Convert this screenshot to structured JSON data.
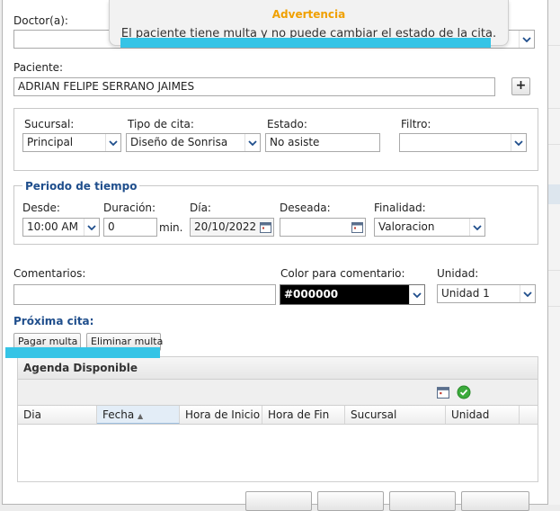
{
  "toast": {
    "title": "Advertencia",
    "message": "El paciente tiene multa y no puede cambiar el estado de la cita."
  },
  "form": {
    "doctor_label": "Doctor(a):",
    "doctor_value": "",
    "paciente_label": "Paciente:",
    "paciente_value": "ADRIAN FELIPE SERRANO JAIMES",
    "add_button": "+",
    "sucursal_label": "Sucursal:",
    "sucursal_value": "Principal",
    "tipo_label": "Tipo de cita:",
    "tipo_value": "Diseño de Sonrisa",
    "estado_label": "Estado:",
    "estado_value": "No asiste",
    "filtro_label": "Filtro:",
    "filtro_value": ""
  },
  "periodo": {
    "legend": "Periodo de tiempo",
    "desde_label": "Desde:",
    "desde_value": "10:00 AM",
    "duracion_label": "Duración:",
    "duracion_value": "0",
    "duracion_unit": "min.",
    "dia_label": "Día:",
    "dia_value": "20/10/2022",
    "deseada_label": "Deseada:",
    "deseada_value": "",
    "finalidad_label": "Finalidad:",
    "finalidad_value": "Valoracion"
  },
  "comentarios": {
    "label": "Comentarios:",
    "value": "",
    "color_label": "Color para comentario:",
    "color_value": "#000000",
    "unidad_label": "Unidad:",
    "unidad_value": "Unidad 1"
  },
  "proxima": {
    "label": "Próxima cita:",
    "pagar": "Pagar multa",
    "eliminar": "Eliminar multa"
  },
  "grid": {
    "title": "Agenda Disponible",
    "columns": [
      "Dia",
      "Fecha",
      "Hora de Inicio",
      "Hora de Fin",
      "Sucursal",
      "Unidad"
    ]
  },
  "colors": {
    "highlight": "#35c4e6",
    "warning": "#f0a000",
    "legend": "#1f4e8c"
  }
}
